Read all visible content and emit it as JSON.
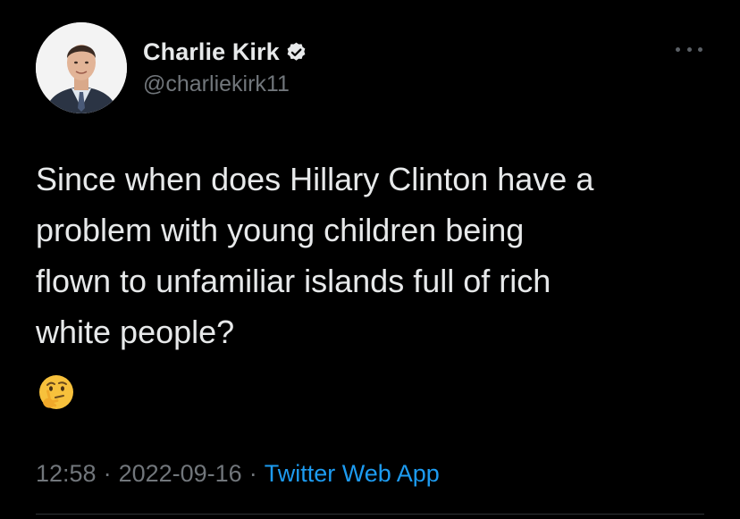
{
  "author": {
    "display_name": "Charlie Kirk",
    "handle": "@charliekirk11",
    "verified": true
  },
  "tweet": {
    "text": "Since when does Hillary Clinton have a\nproblem with young children being\nflown to unfamiliar islands full of rich\nwhite people?",
    "emoji": "🤔"
  },
  "meta": {
    "time": "12:58",
    "date": "2022-09-16",
    "separator": "·",
    "source": "Twitter Web App"
  },
  "icons": {
    "verified": "verified-badge-icon",
    "more": "more-options-icon"
  },
  "colors": {
    "background": "#000000",
    "text": "#e7e9ea",
    "muted": "#71767b",
    "link": "#1d9bf0"
  }
}
